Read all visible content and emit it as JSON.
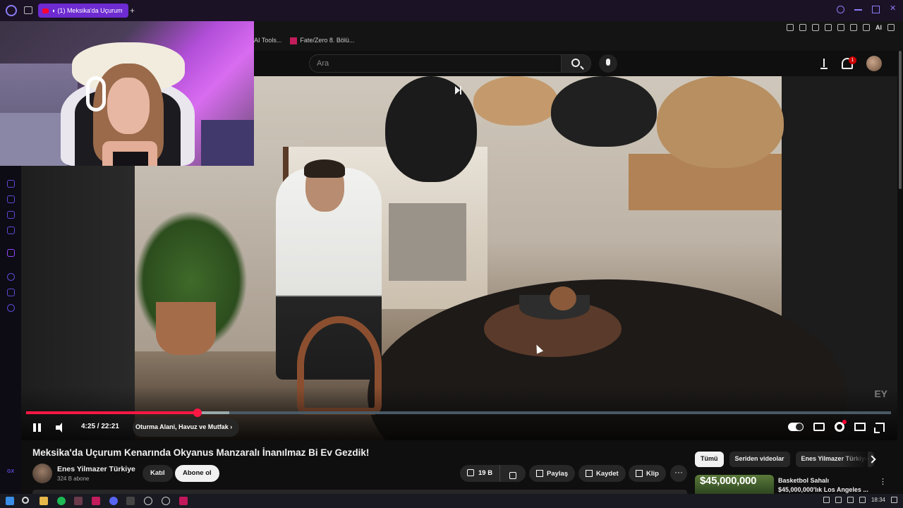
{
  "browser": {
    "tab_title": "(1) Meksika'da Uçurum",
    "bookmarks": [
      "AI Tools...",
      "Fate/Zero 8. Bölü..."
    ],
    "toolbar_ai_label": "AI"
  },
  "masthead": {
    "search_placeholder": "Ara",
    "notification_count": "1"
  },
  "player": {
    "current_time": "4:25",
    "duration": "22:21",
    "time_display": "4:25 / 22:21",
    "progress_played_fraction": 0.198,
    "progress_buffered_fraction": 0.235,
    "chapter_label": "Oturma Alani, Havuz ve Mutfak",
    "watermark": "EY",
    "state": "playing",
    "autoplay": true
  },
  "video": {
    "title": "Meksika'da Uçurum Kenarında Okyanus Manzaralı İnanılmaz Bi Ev Gezdik!",
    "channel_name": "Enes Yilmazer Türkiye",
    "subscribers": "324 B abone",
    "join_label": "Katıl",
    "subscribe_label": "Abone ol",
    "like_count": "19 B",
    "share_label": "Paylaş",
    "save_label": "Kaydet",
    "clip_label": "Klip",
    "more_label": "···"
  },
  "sidebar_chips": [
    "Tümü",
    "Seriden videolar",
    "Enes Yilmazer Türkiye"
  ],
  "recommendation": {
    "thumb_text": "$45,000,000",
    "title": "Basketbol Sahalı",
    "subtitle": "$45,000,000'lık Los Angeles ..."
  },
  "taskbar": {
    "clock": "18:34"
  },
  "colors": {
    "accent_red": "#ff1744",
    "browser_tab_purple": "#6d2bd1",
    "page_bg": "#0f0f0f"
  }
}
